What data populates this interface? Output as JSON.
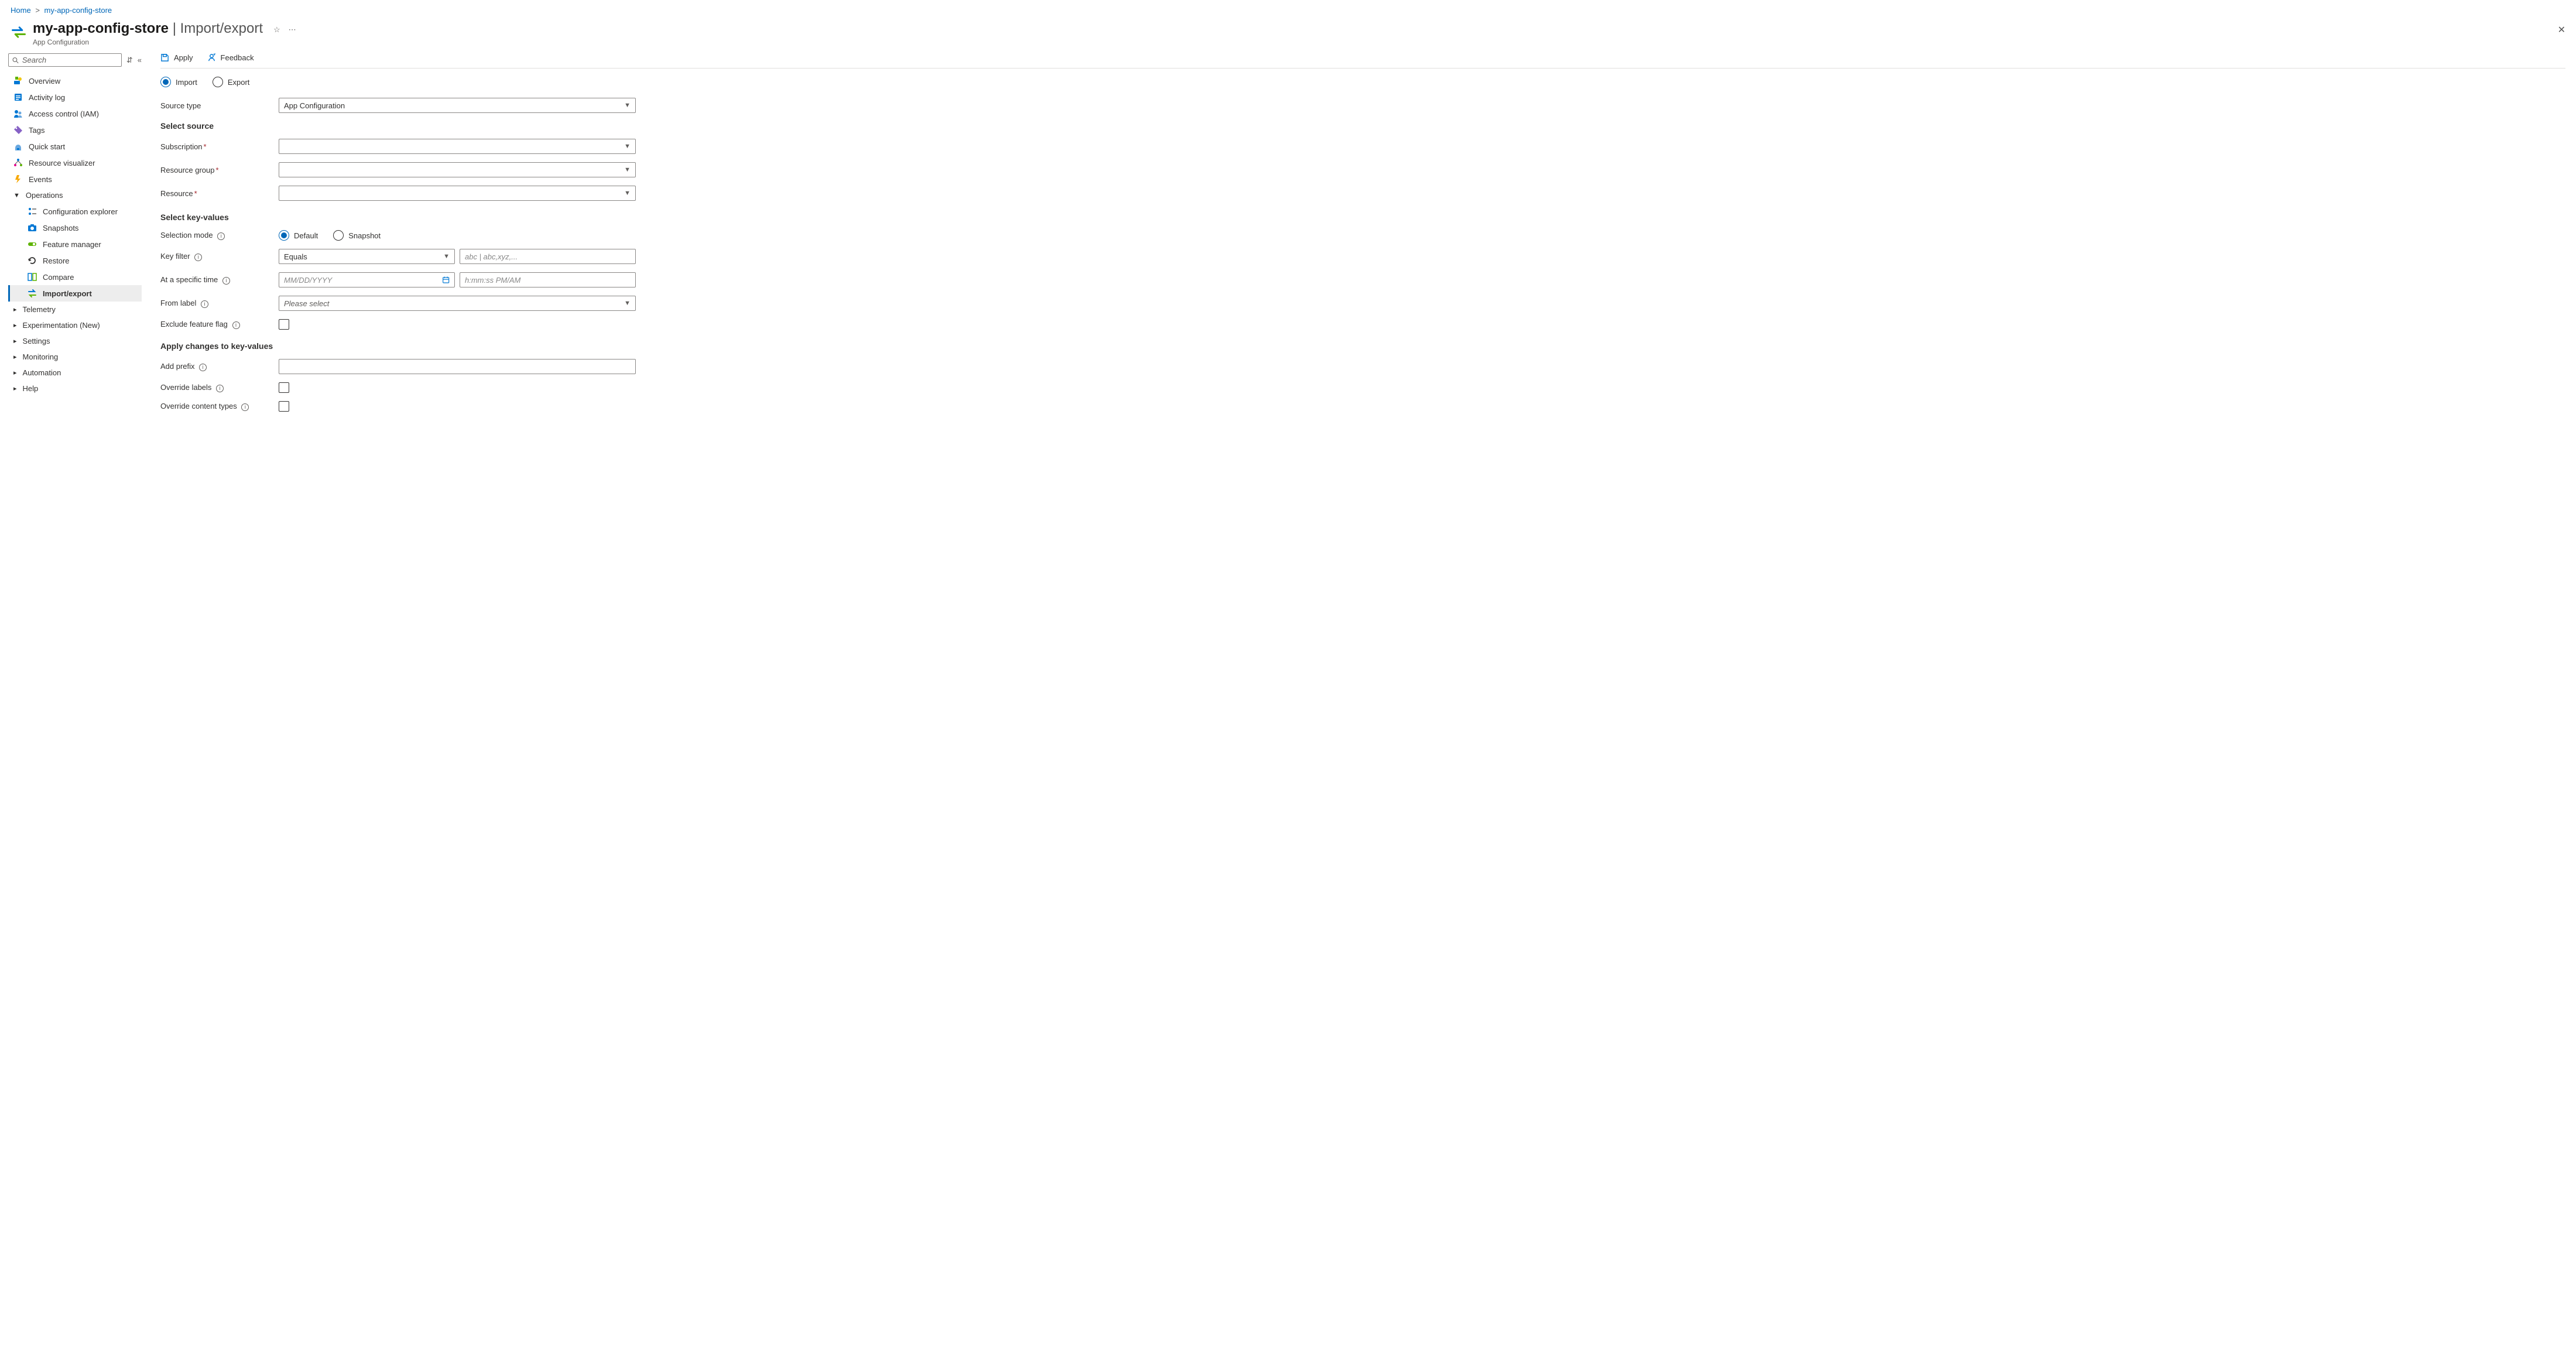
{
  "breadcrumb": {
    "home": "Home",
    "resource": "my-app-config-store"
  },
  "header": {
    "title": "my-app-config-store",
    "page": "Import/export",
    "subtitle": "App Configuration"
  },
  "sidebar": {
    "search_placeholder": "Search",
    "items": {
      "overview": "Overview",
      "activity": "Activity log",
      "iam": "Access control (IAM)",
      "tags": "Tags",
      "quickstart": "Quick start",
      "visualizer": "Resource visualizer",
      "events": "Events",
      "operations": "Operations",
      "configexp": "Configuration explorer",
      "snapshots": "Snapshots",
      "featmgr": "Feature manager",
      "restore": "Restore",
      "compare": "Compare",
      "importexport": "Import/export",
      "telemetry": "Telemetry",
      "experimentation": "Experimentation (New)",
      "settings": "Settings",
      "monitoring": "Monitoring",
      "automation": "Automation",
      "help": "Help"
    }
  },
  "toolbar": {
    "apply": "Apply",
    "feedback": "Feedback"
  },
  "form": {
    "modes": {
      "import": "Import",
      "export": "Export"
    },
    "source_type_label": "Source type",
    "source_type_value": "App Configuration",
    "sections": {
      "select_source": "Select source",
      "select_kv": "Select key-values",
      "apply_changes": "Apply changes to key-values"
    },
    "select_source": {
      "subscription": "Subscription",
      "resource_group": "Resource group",
      "resource": "Resource"
    },
    "select_kv": {
      "selection_mode": "Selection mode",
      "mode_default": "Default",
      "mode_snapshot": "Snapshot",
      "key_filter": "Key filter",
      "key_filter_op": "Equals",
      "key_filter_ph": "abc | abc,xyz,...",
      "at_time": "At a specific time",
      "date_ph": "MM/DD/YYYY",
      "time_ph": "h:mm:ss PM/AM",
      "from_label": "From label",
      "from_label_ph": "Please select",
      "exclude_ff": "Exclude feature flag"
    },
    "apply_changes": {
      "add_prefix": "Add prefix",
      "override_labels": "Override labels",
      "override_ct": "Override content types"
    }
  }
}
